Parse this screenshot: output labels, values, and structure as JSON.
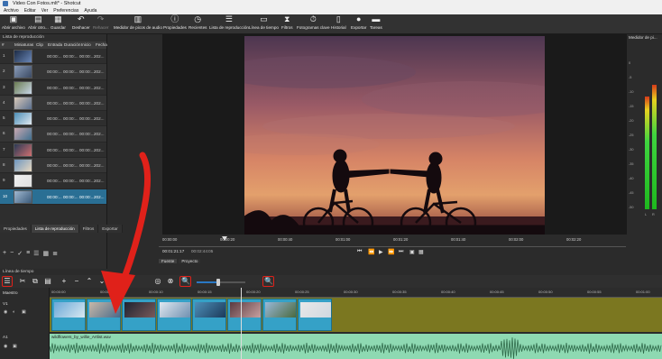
{
  "window": {
    "title": "Video Con Fotos.mlt* - Shotcut"
  },
  "menu": [
    "Archivo",
    "Editar",
    "Ver",
    "Preferencias",
    "Ayuda"
  ],
  "toolbar": [
    {
      "label": "Abrir archivo",
      "icon": "open-file-icon"
    },
    {
      "label": "Abrir otro...",
      "icon": "open-other-icon"
    },
    {
      "label": "Guardar",
      "icon": "save-icon"
    },
    {
      "label": "Deshacer",
      "icon": "undo-icon"
    },
    {
      "label": "Rehacer",
      "icon": "redo-icon"
    },
    {
      "label": "Medidor de picos de audio",
      "icon": "audio-meter-icon"
    },
    {
      "label": "Propiedades",
      "icon": "properties-icon"
    },
    {
      "label": "Recientes",
      "icon": "recent-icon"
    },
    {
      "label": "Lista de reproducción",
      "icon": "playlist-icon"
    },
    {
      "label": "Línea de tiempo",
      "icon": "timeline-icon"
    },
    {
      "label": "Filtros",
      "icon": "filters-icon"
    },
    {
      "label": "Fotogramas clave",
      "icon": "keyframes-icon"
    },
    {
      "label": "Historial",
      "icon": "history-icon"
    },
    {
      "label": "Exportar",
      "icon": "export-icon"
    },
    {
      "label": "Tareas",
      "icon": "jobs-icon"
    }
  ],
  "playlist": {
    "title": "Lista de reproducción",
    "columns": [
      "#",
      "Miniaturas",
      "Clip",
      "Entrada",
      "Duración",
      "Inicio",
      "Fecha"
    ],
    "rows": [
      {
        "num": "1",
        "in": "00:00:...",
        "dur": "00:00:...",
        "start": "00:00:...",
        "date": "202..."
      },
      {
        "num": "2",
        "in": "00:00:...",
        "dur": "00:00:...",
        "start": "00:00:...",
        "date": "202..."
      },
      {
        "num": "3",
        "in": "00:00:...",
        "dur": "00:00:...",
        "start": "00:00:...",
        "date": "202..."
      },
      {
        "num": "4",
        "in": "00:00:...",
        "dur": "00:00:...",
        "start": "00:00:...",
        "date": "202..."
      },
      {
        "num": "5",
        "in": "00:00:...",
        "dur": "00:00:...",
        "start": "00:00:...",
        "date": "202..."
      },
      {
        "num": "6",
        "in": "00:00:...",
        "dur": "00:00:...",
        "start": "00:00:...",
        "date": "202..."
      },
      {
        "num": "7",
        "in": "00:00:...",
        "dur": "00:00:...",
        "start": "00:00:...",
        "date": "202..."
      },
      {
        "num": "8",
        "in": "00:00:...",
        "dur": "00:00:...",
        "start": "00:00:...",
        "date": "202..."
      },
      {
        "num": "9",
        "in": "00:00:...",
        "dur": "00:00:...",
        "start": "00:00:...",
        "date": "202..."
      },
      {
        "num": "10",
        "in": "00:00:...",
        "dur": "00:00:...",
        "start": "00:00:...",
        "date": "202..."
      }
    ],
    "tabs": [
      "Propiedades",
      "Lista de reproducción",
      "Filtros",
      "Exportar"
    ]
  },
  "player": {
    "ruler_ticks": [
      "00:00:00",
      "00:00:20",
      "00:00:40",
      "00:01:00",
      "00:01:20",
      "00:01:40",
      "00:02:00",
      "00:02:20"
    ],
    "timecode_current": "00:01:21:17",
    "timecode_total": "00:02:44:05",
    "tabs": [
      "Fuente",
      "Proyecto"
    ]
  },
  "audio_meter": {
    "title": "Medidor de pi...",
    "scale": [
      "0",
      "-5",
      "-10",
      "-15",
      "-20",
      "-25",
      "-30",
      "-35",
      "-40",
      "-45",
      "-50"
    ],
    "channels": [
      "L",
      "R"
    ],
    "levels": [
      0.78,
      0.86
    ]
  },
  "timeline": {
    "title": "Línea de tiempo",
    "master_label": "Maestro",
    "ruler_ticks": [
      "00:00:00",
      "00:00:05",
      "00:00:10",
      "00:00:15",
      "00:00:20",
      "00:00:25",
      "00:00:30",
      "00:00:35",
      "00:00:40",
      "00:00:45",
      "00:00:50",
      "00:00:55",
      "00:01:00"
    ],
    "v1_label": "V1",
    "a1_label": "A1",
    "audio_clip_name": "wildflowers_by_willie_Artlist.wav",
    "zoom_level": 0.45
  },
  "colors": {
    "accent_highlight": "#e0211a",
    "video_track": "#7b7720",
    "audio_track": "#8ed9b2",
    "clip": "#35a1c7",
    "selection": "#2a6f94"
  }
}
